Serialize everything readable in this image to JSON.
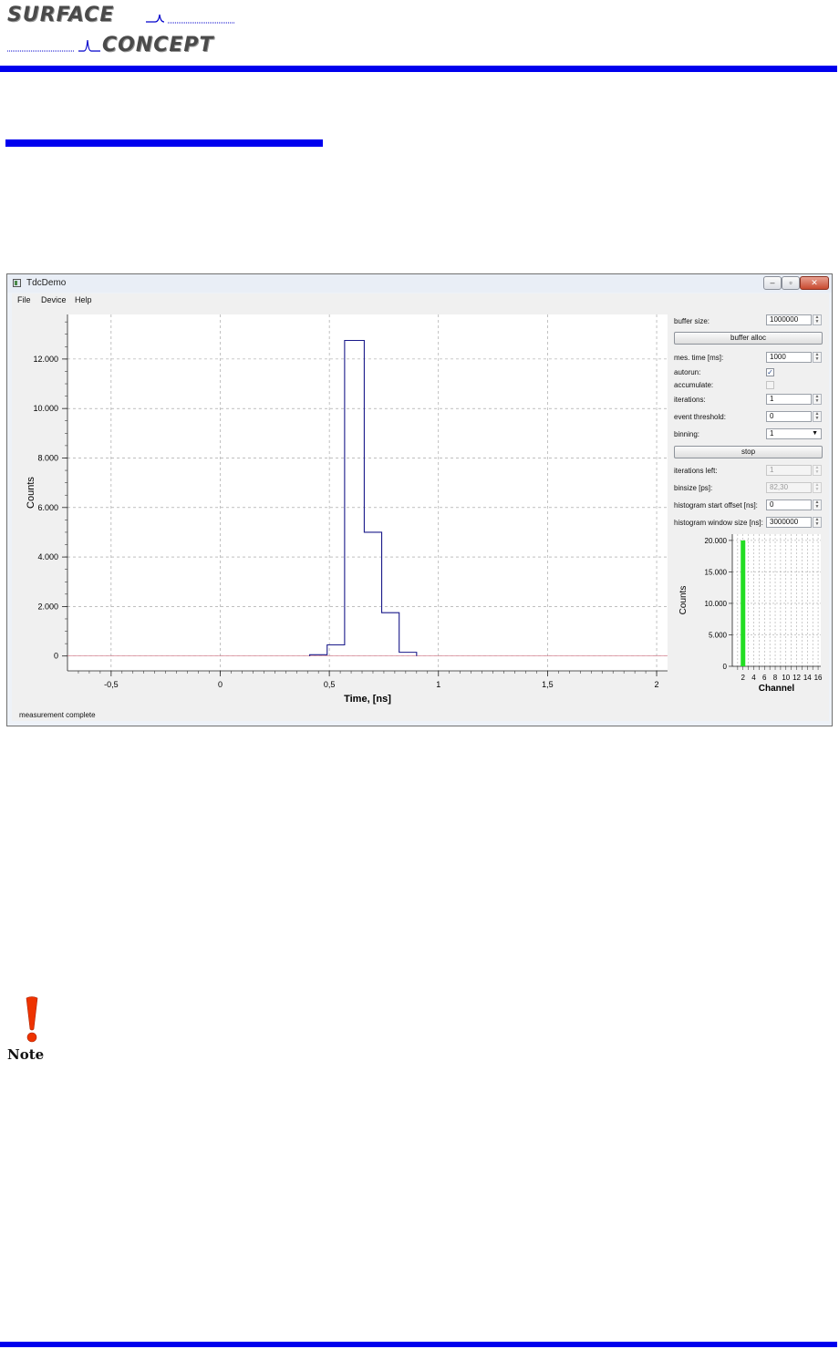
{
  "logo": {
    "line1": "SURFACE",
    "line2": "CONCEPT"
  },
  "colors": {
    "accent_blue": "#0000ee",
    "plot_line": "#1a1a8a",
    "bar_green": "#22dd22",
    "note_red": "#ee3300"
  },
  "window": {
    "title": "TdcDemo",
    "menu": [
      "File",
      "Device",
      "Help"
    ],
    "status": "measurement complete"
  },
  "controls": {
    "buffer_size": {
      "label": "buffer size:",
      "value": "1000000"
    },
    "buffer_alloc_button": "buffer alloc",
    "mes_time": {
      "label": "mes. time [ms]:",
      "value": "1000"
    },
    "autorun": {
      "label": "autorun:",
      "checked": true
    },
    "accumulate": {
      "label": "accumulate:",
      "checked": false
    },
    "iterations": {
      "label": "iterations:",
      "value": "1"
    },
    "event_threshold": {
      "label": "event threshold:",
      "value": "0"
    },
    "binning": {
      "label": "binning:",
      "value": "1"
    },
    "stop_button": "stop",
    "iterations_left": {
      "label": "iterations left:",
      "value": "1"
    },
    "binsize": {
      "label": "binsize [ps]:",
      "value": "82,30"
    },
    "histogram_start_offset": {
      "label": "histogram start offset [ns]:",
      "value": "0"
    },
    "histogram_window_size": {
      "label": "histogram window size [ns]:",
      "value": "3000000"
    }
  },
  "note_label": "Note",
  "chart_data": [
    {
      "type": "line",
      "xlabel": "Time, [ns]",
      "ylabel": "Counts",
      "xlim": [
        -0.7,
        2.05
      ],
      "ylim": [
        -600,
        13800
      ],
      "x_ticks": [
        -0.5,
        0,
        0.5,
        1,
        1.5,
        2
      ],
      "x_tick_labels": [
        "-0,5",
        "0",
        "0,5",
        "1",
        "1,5",
        "2"
      ],
      "y_ticks": [
        0,
        2000,
        4000,
        6000,
        8000,
        10000,
        12000
      ],
      "y_tick_labels": [
        "0",
        "2.000",
        "4.000",
        "6.000",
        "8.000",
        "10.000",
        "12.000"
      ],
      "grid": true,
      "series": [
        {
          "step_edges": [
            0.41,
            0.49,
            0.57,
            0.66,
            0.74,
            0.82,
            0.9
          ],
          "values": [
            50,
            450,
            12750,
            5000,
            1750,
            150
          ]
        }
      ]
    },
    {
      "type": "bar",
      "xlabel": "Channel",
      "ylabel": "Counts",
      "xlim": [
        0,
        16.5
      ],
      "ylim": [
        0,
        21000
      ],
      "x_ticks": [
        2,
        4,
        6,
        8,
        10,
        12,
        14,
        16
      ],
      "x_tick_labels": [
        "2",
        "4",
        "6",
        "8",
        "10",
        "12",
        "14",
        "16"
      ],
      "y_ticks": [
        0,
        5000,
        10000,
        15000,
        20000
      ],
      "y_tick_labels": [
        "0",
        "5.000",
        "10.000",
        "15.000",
        "20.000"
      ],
      "grid": true,
      "categories": [
        2
      ],
      "values": [
        20000
      ]
    }
  ]
}
